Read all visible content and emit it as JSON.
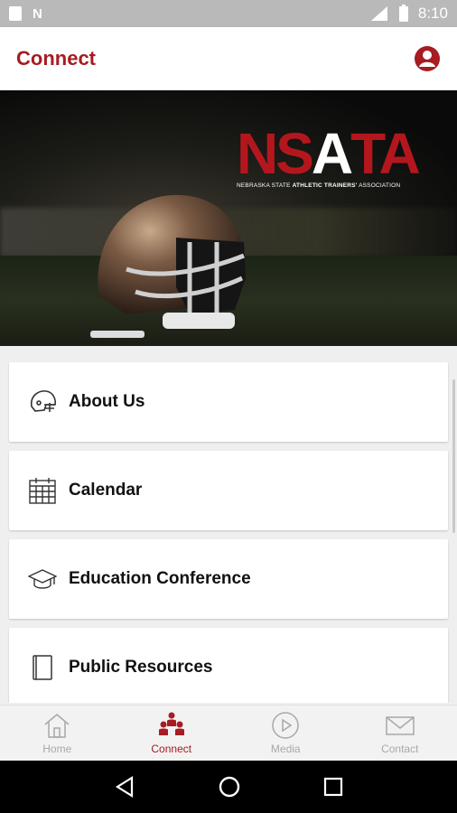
{
  "statusbar": {
    "carrier_label": "N",
    "network": "LTE",
    "time": "8:10"
  },
  "appbar": {
    "title": "Connect"
  },
  "hero": {
    "logo": {
      "letters": "NSATA",
      "tagline_prefix": "NEBRASKA STATE ",
      "tagline_bold": "ATHLETIC TRAINERS'",
      "tagline_suffix": " ASSOCIATION"
    }
  },
  "menu": {
    "items": [
      {
        "label": "About Us",
        "icon": "helmet-icon"
      },
      {
        "label": "Calendar",
        "icon": "calendar-icon"
      },
      {
        "label": "Education Conference",
        "icon": "graduation-cap-icon"
      },
      {
        "label": "Public Resources",
        "icon": "book-icon"
      }
    ]
  },
  "bottom_nav": {
    "items": [
      {
        "label": "Home",
        "icon": "home-icon",
        "active": false
      },
      {
        "label": "Connect",
        "icon": "people-icon",
        "active": true
      },
      {
        "label": "Media",
        "icon": "play-icon",
        "active": false
      },
      {
        "label": "Contact",
        "icon": "envelope-icon",
        "active": false
      }
    ]
  },
  "colors": {
    "brand": "#a61c22",
    "inactive": "#a8a8a8",
    "background": "#efefef"
  }
}
